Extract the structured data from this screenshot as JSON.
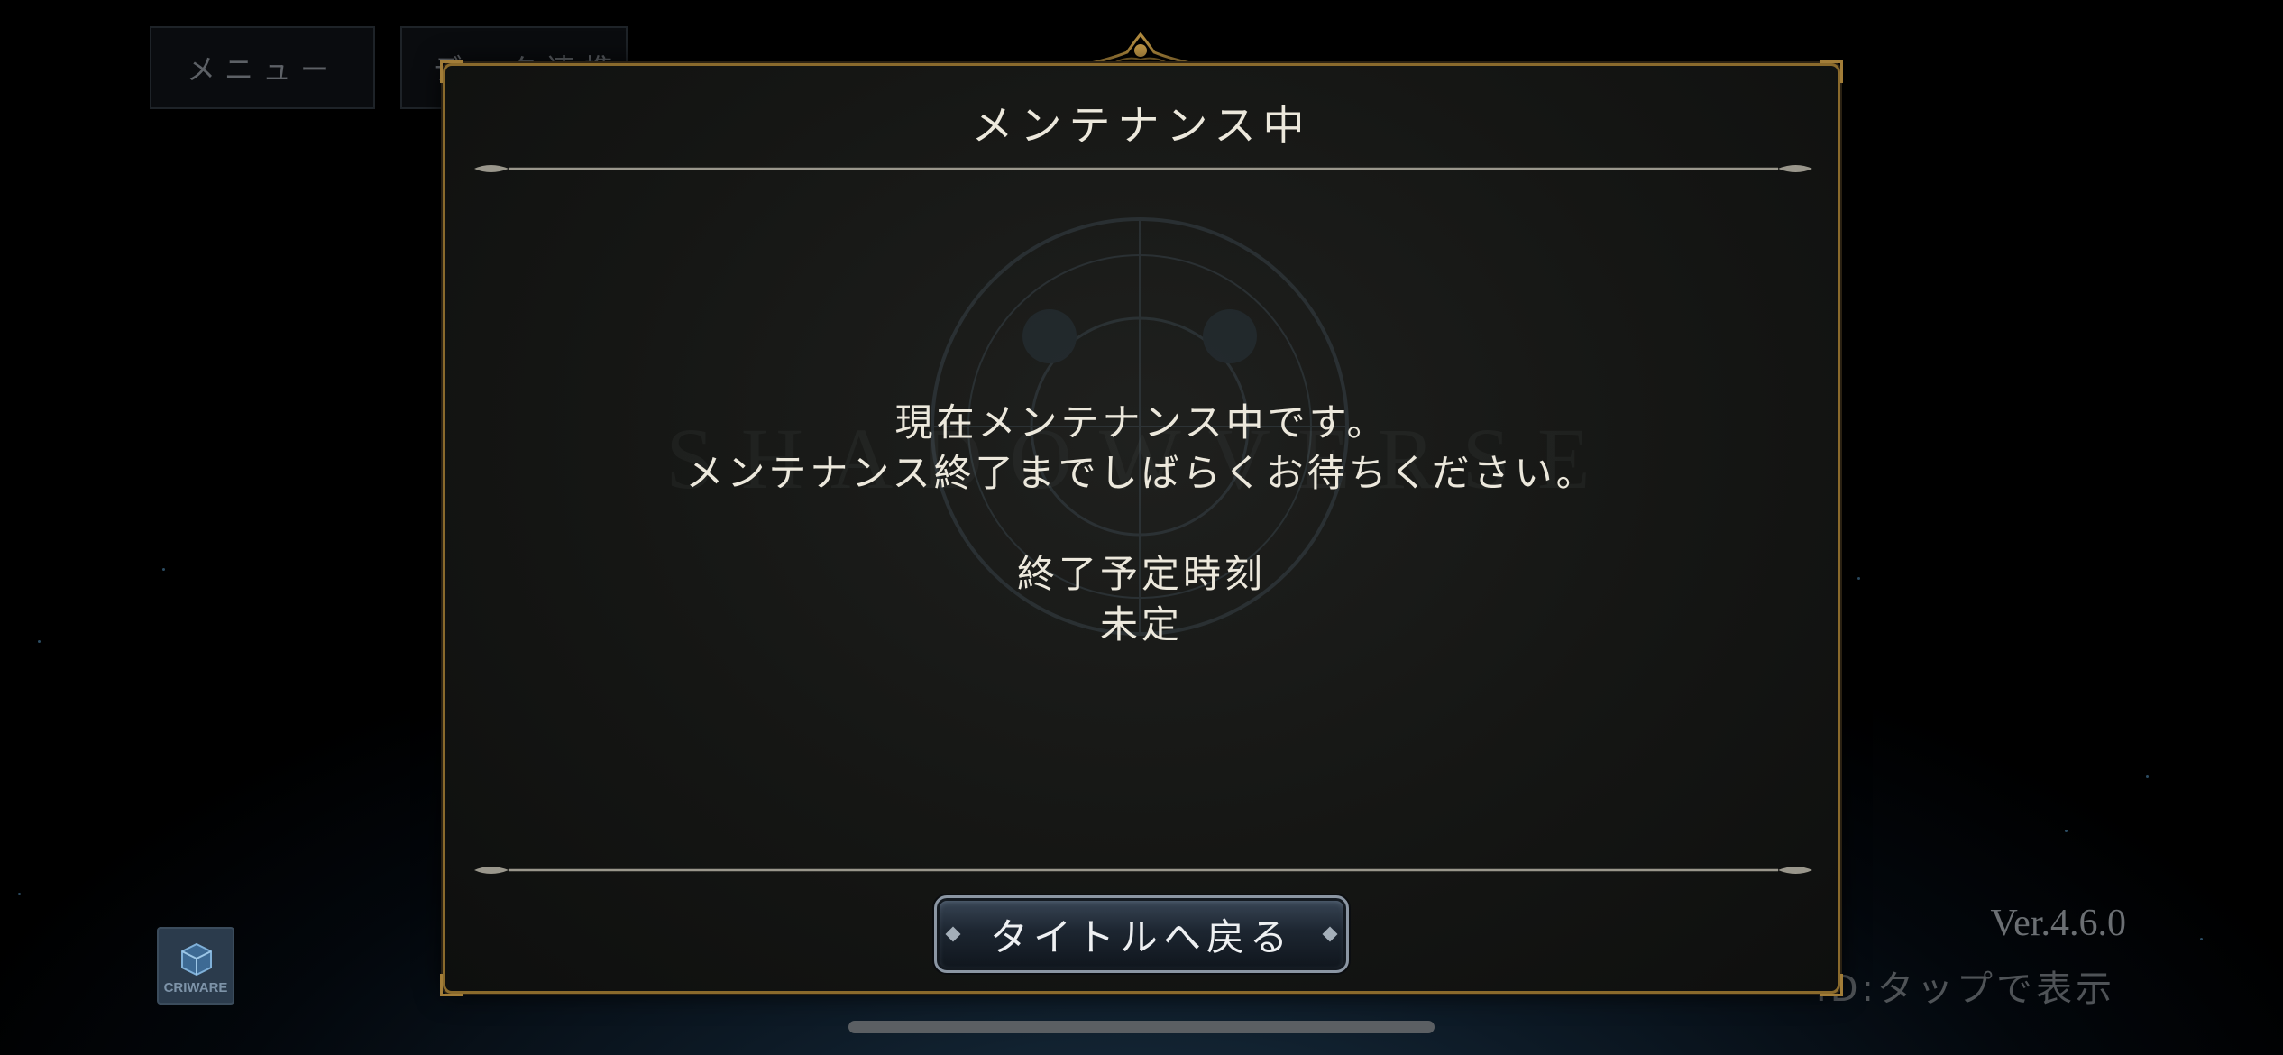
{
  "top_buttons": {
    "menu_label": "メニュー",
    "data_link_label": "データ連携"
  },
  "criware": {
    "label": "CRIWARE"
  },
  "footer": {
    "version": "Ver.4.6.0",
    "id_hint": "ID:タップで表示"
  },
  "background": {
    "watermark": "SHADOWVERSE"
  },
  "dialog": {
    "title": "メンテナンス中",
    "message_line1": "現在メンテナンス中です。",
    "message_line2": "メンテナンス終了までしばらくお待ちください。",
    "end_time_label": "終了予定時刻",
    "end_time_value": "未定",
    "back_button_label": "タイトルへ戻る"
  },
  "colors": {
    "frame_gold": "#8a6a2c",
    "text_light": "#ece8dc",
    "button_steel": "#8b96a3"
  }
}
